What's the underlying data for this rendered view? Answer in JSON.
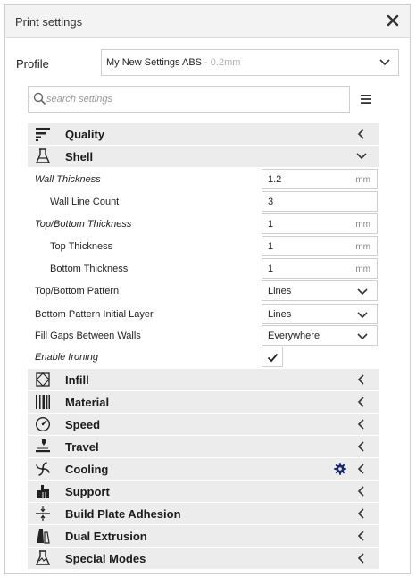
{
  "window": {
    "title": "Print settings"
  },
  "profile": {
    "label": "Profile",
    "name": "My New Settings ABS",
    "sub": " - 0.2mm"
  },
  "search": {
    "placeholder": "search settings"
  },
  "categories_top": [
    {
      "label": "Quality",
      "icon": "quality-icon",
      "state": "collapsed"
    },
    {
      "label": "Shell",
      "icon": "shell-icon",
      "state": "expanded"
    }
  ],
  "shell_settings": {
    "wall_thickness": {
      "label": "Wall Thickness",
      "value": "1.2",
      "unit": "mm"
    },
    "wall_line_count": {
      "label": "Wall Line Count",
      "value": "3"
    },
    "top_bottom_thickness": {
      "label": "Top/Bottom Thickness",
      "value": "1",
      "unit": "mm"
    },
    "top_thickness": {
      "label": "Top Thickness",
      "value": "1",
      "unit": "mm"
    },
    "bottom_thickness": {
      "label": "Bottom Thickness",
      "value": "1",
      "unit": "mm"
    },
    "top_bottom_pattern": {
      "label": "Top/Bottom Pattern",
      "value": "Lines"
    },
    "bottom_pattern_initial_layer": {
      "label": "Bottom Pattern Initial Layer",
      "value": "Lines"
    },
    "fill_gaps_between_walls": {
      "label": "Fill Gaps Between Walls",
      "value": "Everywhere"
    },
    "enable_ironing": {
      "label": "Enable Ironing",
      "checked": true
    }
  },
  "categories_bottom": [
    {
      "label": "Infill",
      "icon": "infill-icon"
    },
    {
      "label": "Material",
      "icon": "material-icon"
    },
    {
      "label": "Speed",
      "icon": "speed-icon"
    },
    {
      "label": "Travel",
      "icon": "travel-icon"
    },
    {
      "label": "Cooling",
      "icon": "cooling-icon",
      "gear": true
    },
    {
      "label": "Support",
      "icon": "support-icon"
    },
    {
      "label": "Build Plate Adhesion",
      "icon": "build-plate-adhesion-icon"
    },
    {
      "label": "Dual Extrusion",
      "icon": "dual-extrusion-icon"
    },
    {
      "label": "Special Modes",
      "icon": "special-modes-icon"
    }
  ],
  "colors": {
    "category_bg": "#ececec",
    "gear": "#1a2a6c",
    "border": "#cfcfcf"
  }
}
